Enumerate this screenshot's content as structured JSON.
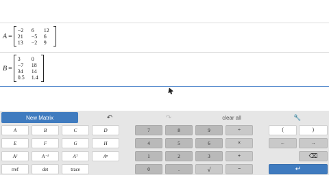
{
  "matrices": [
    {
      "name": "A",
      "rows": [
        [
          "−2",
          "6",
          "12"
        ],
        [
          "21",
          "−5",
          "6"
        ],
        [
          "13",
          "−2",
          "9"
        ]
      ]
    },
    {
      "name": "B",
      "rows": [
        [
          "3",
          "0"
        ],
        [
          "−7",
          "18"
        ],
        [
          "34",
          "14"
        ],
        [
          "0.5",
          "1.4"
        ]
      ]
    }
  ],
  "equals_sign": "=",
  "toolbar": {
    "new_matrix_label": "New Matrix",
    "undo_icon": "undo-icon",
    "redo_icon": "redo-icon",
    "clear_all_label": "clear all",
    "settings_icon": "wrench-icon",
    "undo_glyph": "↶",
    "redo_glyph": "↷",
    "wrench_glyph": "🔧"
  },
  "keys": {
    "vars_row1": [
      "A",
      "B",
      "C",
      "D"
    ],
    "vars_row2": [
      "E",
      "F",
      "G",
      "H"
    ],
    "ops_row3": [
      "A²",
      "A⁻¹",
      "Aᵀ",
      "Aⁿ"
    ],
    "ops_row4": [
      "rref",
      "det",
      "trace"
    ],
    "num_row1": [
      "7",
      "8",
      "9",
      "÷"
    ],
    "num_row2": [
      "4",
      "5",
      "6",
      "×"
    ],
    "num_row3": [
      "1",
      "2",
      "3",
      "+"
    ],
    "num_row4": [
      "0",
      ".",
      "√",
      "−"
    ],
    "right_row1": [
      "(",
      ")"
    ],
    "right_row2": [
      "←",
      "→"
    ],
    "backspace": "⌫",
    "enter": "↵"
  },
  "colors": {
    "accent": "#3f7bbf",
    "keypad_bg": "#e6e6e6"
  }
}
